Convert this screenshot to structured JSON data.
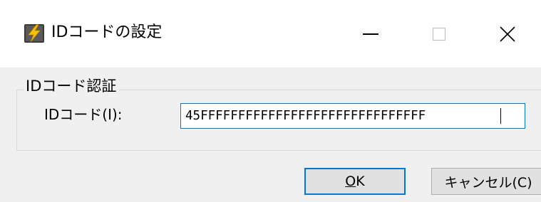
{
  "window": {
    "title": "IDコードの設定",
    "icon": "lightning-app-icon",
    "controls": {
      "minimize": "minimize-icon",
      "maximize": "maximize-icon",
      "close": "close-icon"
    }
  },
  "group": {
    "legend": "IDコード認証",
    "field_label": "IDコード(I):",
    "id_code_value": "45FFFFFFFFFFFFFFFFFFFFFFFFFFFFFF"
  },
  "buttons": {
    "ok_label_accel": "O",
    "ok_label_rest": "K",
    "cancel_label": "キャンセル(C)"
  },
  "colors": {
    "focus_border": "#0078d7",
    "dialog_bg": "#f0f0f0",
    "titlebar_bg": "#ffffff"
  }
}
